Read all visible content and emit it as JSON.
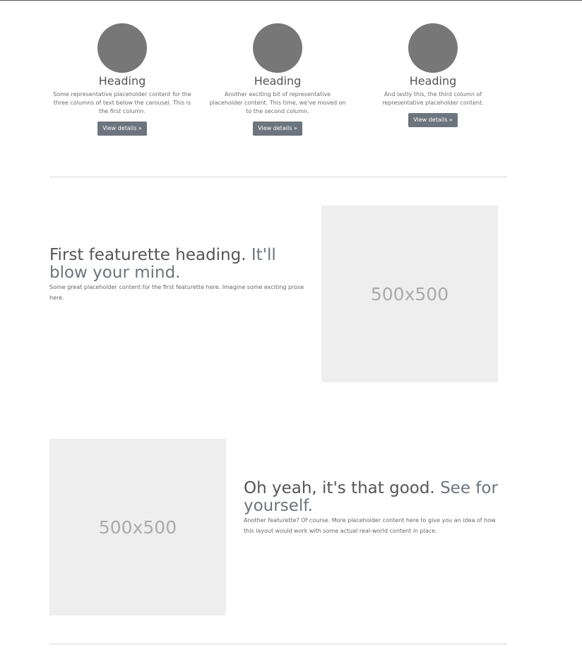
{
  "columns": [
    {
      "heading": "Heading",
      "text": "Some representative placeholder content for the three columns of text below the carousel. This is the first column.",
      "button": "View details »"
    },
    {
      "heading": "Heading",
      "text": "Another exciting bit of representative placeholder content. This time, we've moved on to the second column.",
      "button": "View details »"
    },
    {
      "heading": "Heading",
      "text": "And lastly this, the third column of representative placeholder content.",
      "button": "View details »"
    }
  ],
  "featurettes": [
    {
      "heading": "First featurette heading.",
      "heading_muted": "It'll blow your mind.",
      "body": "Some great placeholder content for the first featurette here. Imagine some exciting prose here.",
      "image_label": "500x500"
    },
    {
      "heading": "Oh yeah, it's that good.",
      "heading_muted": "See for yourself.",
      "body": "Another featurette? Of course. More placeholder content here to give you an idea of how this layout would work with some actual real-world content in place.",
      "image_label": "500x500"
    }
  ],
  "colors": {
    "circle": "#777777",
    "button": "#6c757d",
    "placeholder_bg": "#eeeeee",
    "placeholder_text": "#aaaaaa"
  }
}
